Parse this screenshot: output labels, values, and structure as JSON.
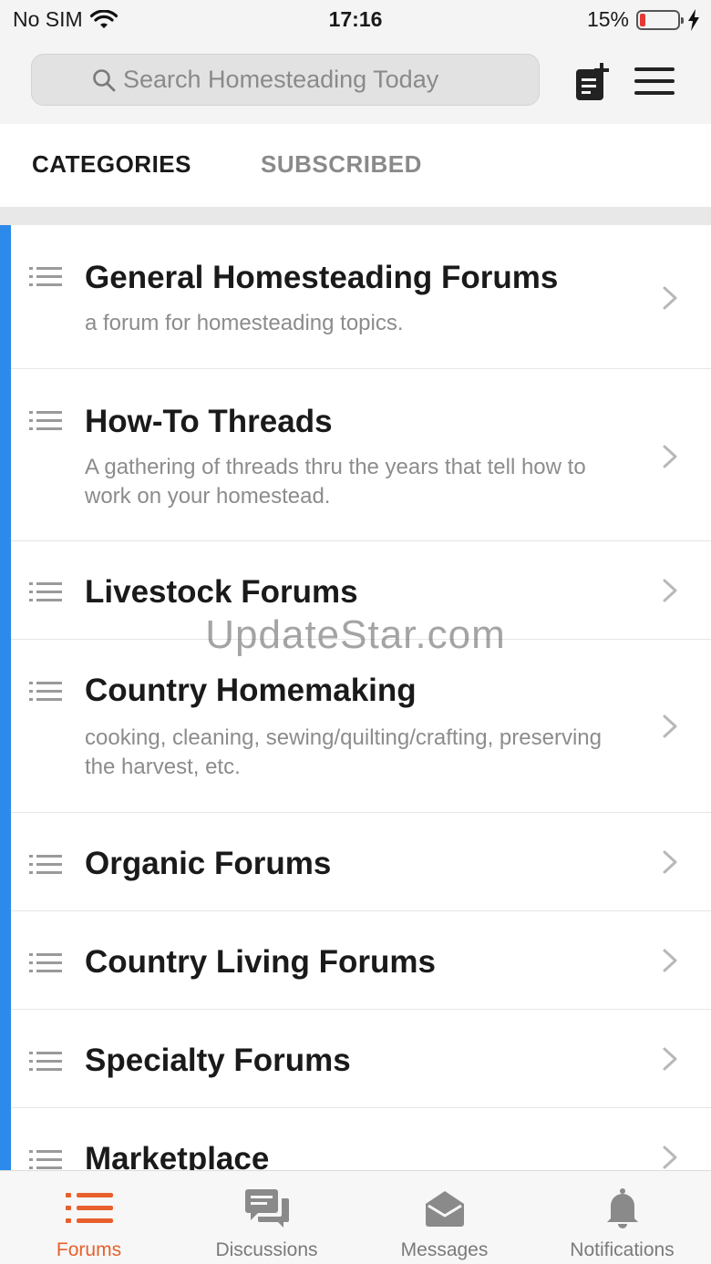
{
  "status_bar": {
    "carrier": "No SIM",
    "time": "17:16",
    "battery": "15%",
    "battery_level": 0.15
  },
  "search": {
    "placeholder": "Search Homesteading Today"
  },
  "tabs": [
    {
      "label": "CATEGORIES",
      "active": true
    },
    {
      "label": "SUBSCRIBED",
      "active": false
    }
  ],
  "forums": [
    {
      "title": "General Homesteading Forums",
      "description": "a forum for homesteading topics."
    },
    {
      "title": "How-To Threads",
      "description": "A gathering of threads thru the years that tell how to work on your homestead."
    },
    {
      "title": "Livestock Forums",
      "description": ""
    },
    {
      "title": "Country Homemaking",
      "description": "cooking, cleaning, sewing/quilting/crafting, preserving the harvest, etc."
    },
    {
      "title": "Organic Forums",
      "description": ""
    },
    {
      "title": "Country Living Forums",
      "description": ""
    },
    {
      "title": "Specialty Forums",
      "description": ""
    },
    {
      "title": "Marketplace",
      "description": ""
    }
  ],
  "watermark": "UpdateStar.com",
  "bottom_nav": [
    {
      "label": "Forums",
      "icon": "list-icon",
      "active": true
    },
    {
      "label": "Discussions",
      "icon": "chat-bubbles-icon",
      "active": false
    },
    {
      "label": "Messages",
      "icon": "envelope-icon",
      "active": false
    },
    {
      "label": "Notifications",
      "icon": "bell-icon",
      "active": false
    }
  ],
  "colors": {
    "accent_blue": "#2c8bea",
    "active_orange": "#e8602c",
    "battery_red": "#e53935"
  }
}
